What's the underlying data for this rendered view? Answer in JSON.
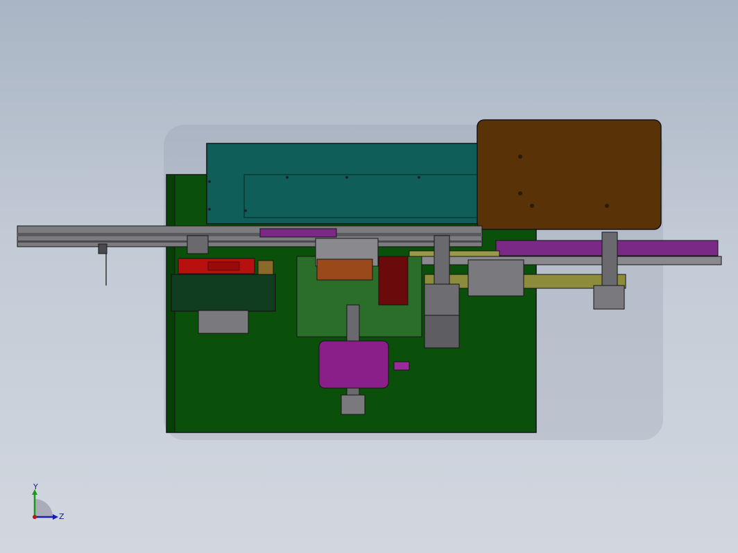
{
  "viewport": {
    "background_top": "#a9b5c4",
    "background_bottom": "#d2d7df"
  },
  "model": {
    "colors": {
      "base_plate": "#0a4f0a",
      "cover_teal": "#0f5e5a",
      "brown_plate": "#5a3208",
      "red_block": "#b80f0f",
      "magenta": "#8a1f8a",
      "purple_belt": "#7a2a86",
      "gray_part": "#6e6e72",
      "olive_rail": "#8c8c3c",
      "outline": "#151515"
    }
  },
  "triad": {
    "y_label": "Y",
    "z_label": "Z",
    "y_color": "#1a9a1a",
    "z_color": "#1a1ab4",
    "x_color": "#b41a1a"
  }
}
